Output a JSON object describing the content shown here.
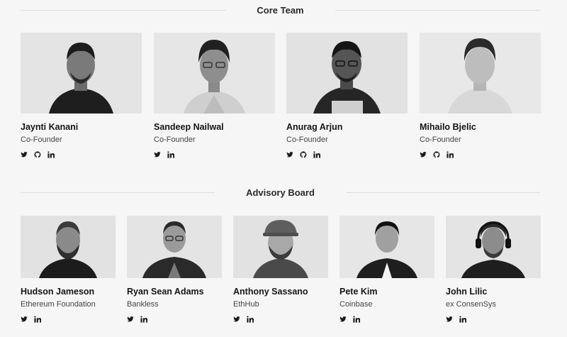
{
  "core_team": {
    "title": "Core Team",
    "members": [
      {
        "name": "Jaynti Kanani",
        "role": "Co-Founder",
        "socials": [
          "twitter",
          "github",
          "linkedin"
        ],
        "photo_alt": "Jaynti Kanani portrait"
      },
      {
        "name": "Sandeep Nailwal",
        "role": "Co-Founder",
        "socials": [
          "twitter",
          "linkedin"
        ],
        "photo_alt": "Sandeep Nailwal portrait"
      },
      {
        "name": "Anurag Arjun",
        "role": "Co-Founder",
        "socials": [
          "twitter",
          "github",
          "linkedin"
        ],
        "photo_alt": "Anurag Arjun portrait"
      },
      {
        "name": "Mihailo Bjelic",
        "role": "Co-Founder",
        "socials": [
          "twitter",
          "github",
          "linkedin"
        ],
        "photo_alt": "Mihailo Bjelic portrait"
      }
    ]
  },
  "advisory_board": {
    "title": "Advisory Board",
    "members": [
      {
        "name": "Hudson Jameson",
        "role": "Ethereum Foundation",
        "socials": [
          "twitter",
          "linkedin"
        ],
        "photo_alt": "Hudson Jameson portrait"
      },
      {
        "name": "Ryan Sean Adams",
        "role": "Bankless",
        "socials": [
          "twitter",
          "linkedin"
        ],
        "photo_alt": "Ryan Sean Adams portrait"
      },
      {
        "name": "Anthony Sassano",
        "role": "EthHub",
        "socials": [
          "twitter",
          "linkedin"
        ],
        "photo_alt": "Anthony Sassano portrait"
      },
      {
        "name": "Pete Kim",
        "role": "Coinbase",
        "socials": [
          "twitter",
          "linkedin"
        ],
        "photo_alt": "Pete Kim portrait"
      },
      {
        "name": "John Lilic",
        "role": "ex ConsenSys",
        "socials": [
          "twitter",
          "linkedin"
        ],
        "photo_alt": "John Lilic portrait"
      }
    ]
  },
  "colors": {
    "background": "#f6f6f6",
    "photo_bg": "#e4e4e4",
    "text": "#1a1a1a",
    "rule": "#dcdcdc"
  }
}
